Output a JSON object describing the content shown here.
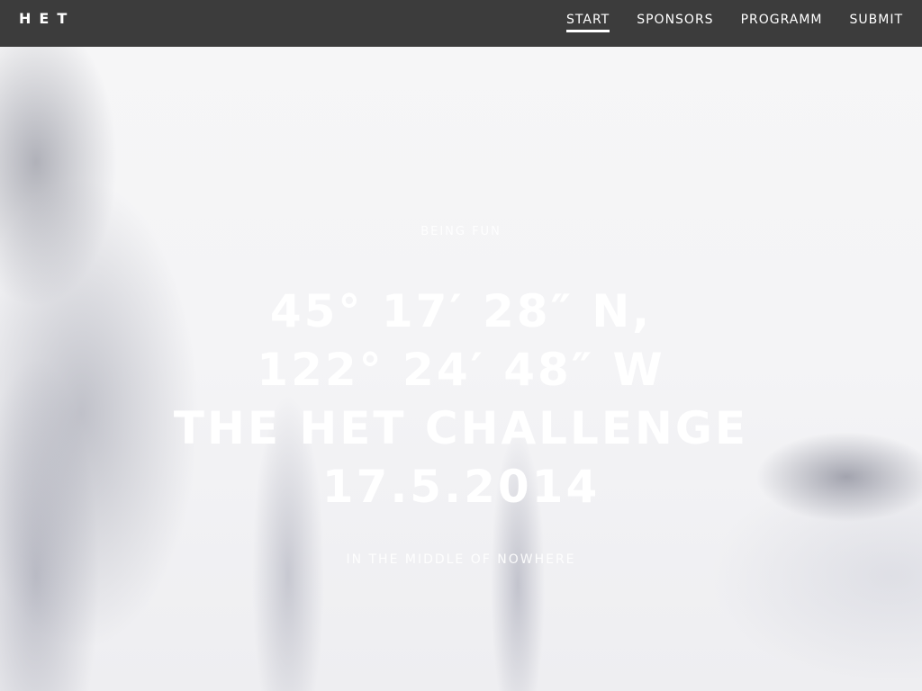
{
  "nav": {
    "logo": "HET",
    "items": [
      {
        "label": "START",
        "active": true
      },
      {
        "label": "SPONSORS",
        "active": false
      },
      {
        "label": "PROGRAMM",
        "active": false
      },
      {
        "label": "SUBMIT",
        "active": false
      }
    ]
  },
  "hero": {
    "kicker": "BEING FUN",
    "headline_lines": [
      "45° 17′ 28″ N,",
      "122° 24′ 48″ W",
      "THE HET CHALLENGE",
      "17.5.2014"
    ],
    "tagline": "IN THE MIDDLE OF NOWHERE"
  }
}
